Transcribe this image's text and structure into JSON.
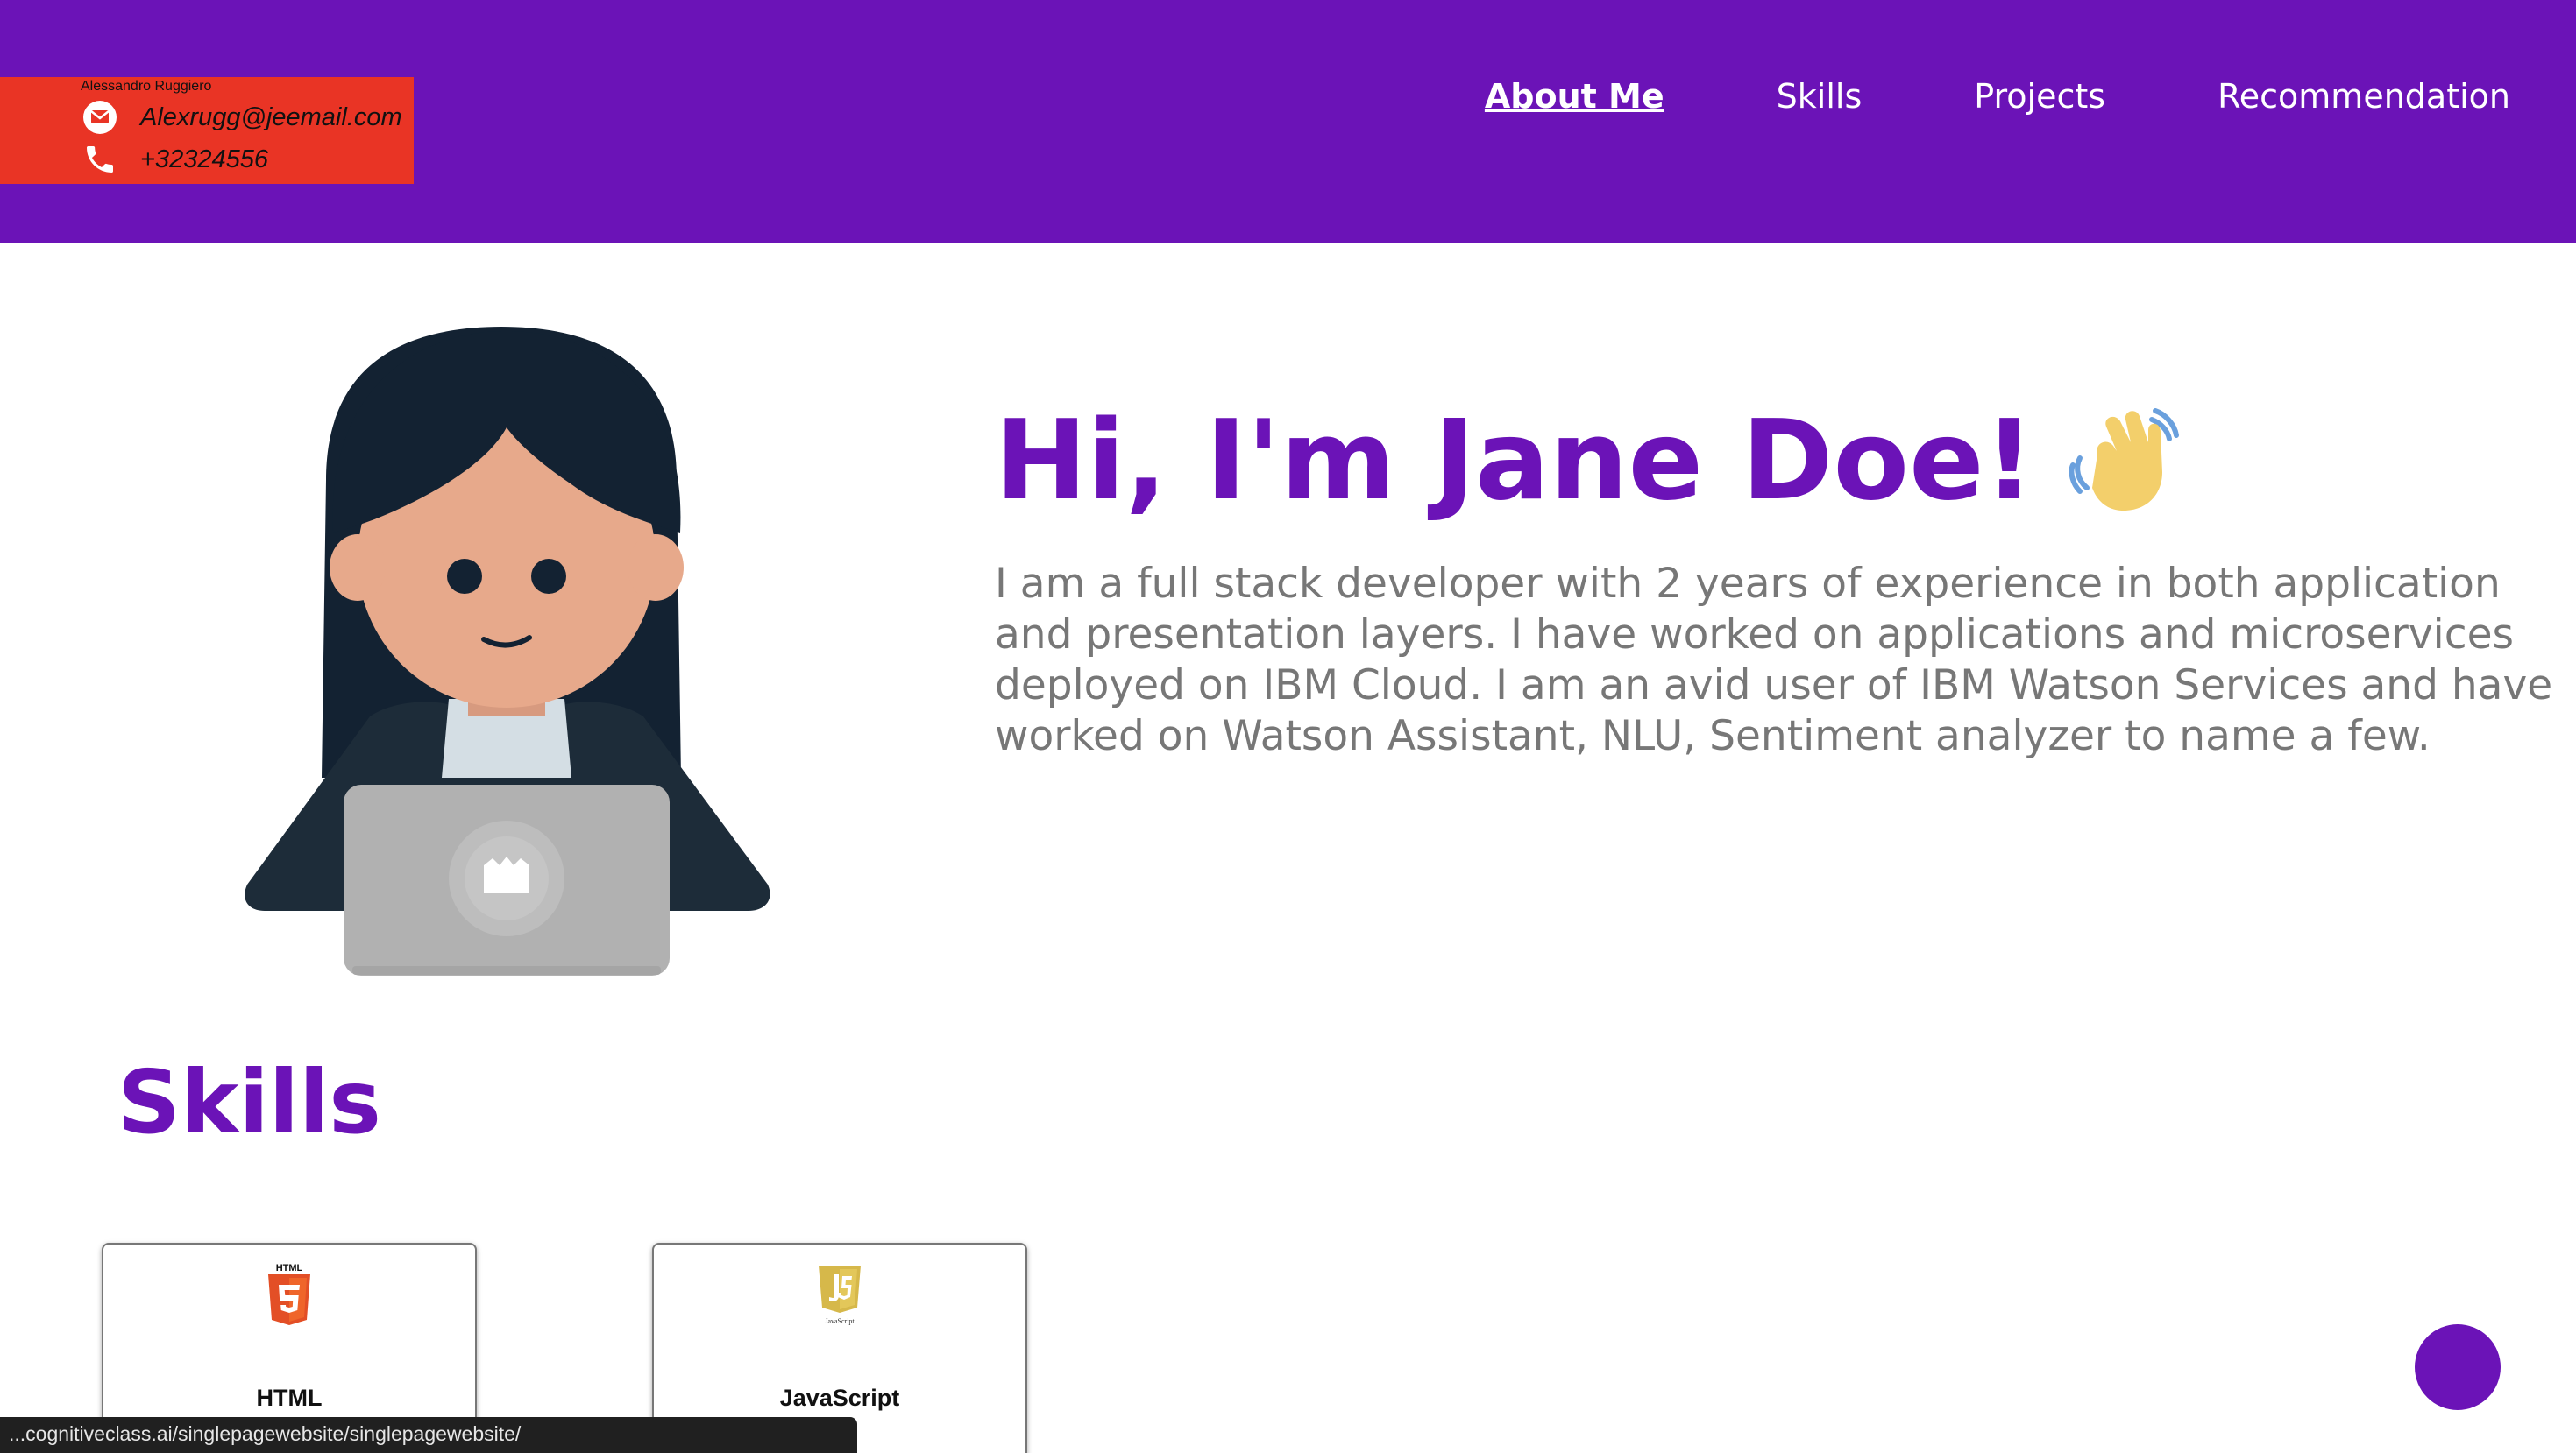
{
  "contact": {
    "name": "Alessandro Ruggiero",
    "email": "Alexrugg@jeemail.com",
    "phone": "+32324556",
    "email_icon": "email-icon",
    "phone_icon": "phone-icon"
  },
  "nav": {
    "items": [
      {
        "label": "About Me",
        "active": true
      },
      {
        "label": "Skills"
      },
      {
        "label": "Projects"
      },
      {
        "label": "Recommendation"
      }
    ]
  },
  "hero": {
    "title": "Hi, I'm Jane Doe!",
    "wave_icon": "waving-hand-icon",
    "description": "I am a full stack developer with 2 years of experience in both application and presentation layers. I have worked on applications and microservices deployed on IBM Cloud. I am an avid user of IBM Watson Services and have worked on Watson Assistant, NLU, Sentiment analyzer to name a few."
  },
  "skills": {
    "title": "Skills",
    "items": [
      {
        "label": "HTML",
        "logo_text": "HTML",
        "icon": "html5-logo-icon"
      },
      {
        "label": "JavaScript",
        "logo_text": "JavaScript",
        "icon": "javascript-logo-icon"
      }
    ]
  },
  "status_bar": {
    "url": "...cognitiveclass.ai/singlepagewebsite/singlepagewebsite/"
  },
  "colors": {
    "brand": "#6b13b7",
    "contact_bg": "#e93425",
    "text_gray": "#777777"
  }
}
